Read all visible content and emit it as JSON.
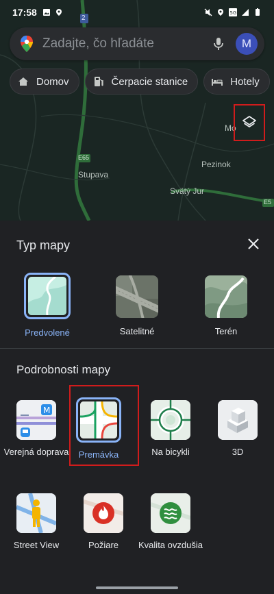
{
  "status_bar": {
    "time": "17:58"
  },
  "search": {
    "placeholder": "Zadajte, čo hľadáte",
    "avatar_letter": "M"
  },
  "chips": [
    {
      "icon": "home-icon",
      "label": "Domov"
    },
    {
      "icon": "gas-station-icon",
      "label": "Čerpacie stanice"
    },
    {
      "icon": "hotel-bed-icon",
      "label": "Hotely"
    }
  ],
  "map": {
    "labels": [
      "Stupava",
      "Pezinok",
      "Svätý Jur",
      "Mo",
      "E65",
      "2",
      "E5"
    ]
  },
  "sheet": {
    "map_type_title": "Typ mapy",
    "map_types": [
      {
        "label": "Predvolené",
        "selected": true
      },
      {
        "label": "Satelitné",
        "selected": false
      },
      {
        "label": "Terén",
        "selected": false
      }
    ],
    "details_title": "Podrobnosti mapy",
    "details": [
      {
        "label": "Verejná doprava",
        "selected": false
      },
      {
        "label": "Premávka",
        "selected": true
      },
      {
        "label": "Na bicykli",
        "selected": false
      },
      {
        "label": "3D",
        "selected": false
      },
      {
        "label": "Street View",
        "selected": false
      },
      {
        "label": "Požiare",
        "selected": false
      },
      {
        "label": "Kvalita ovzdušia",
        "selected": false
      }
    ]
  },
  "colors": {
    "accent": "#8ab4f8",
    "highlight": "#d01c1c",
    "sheet_bg": "#202124"
  }
}
